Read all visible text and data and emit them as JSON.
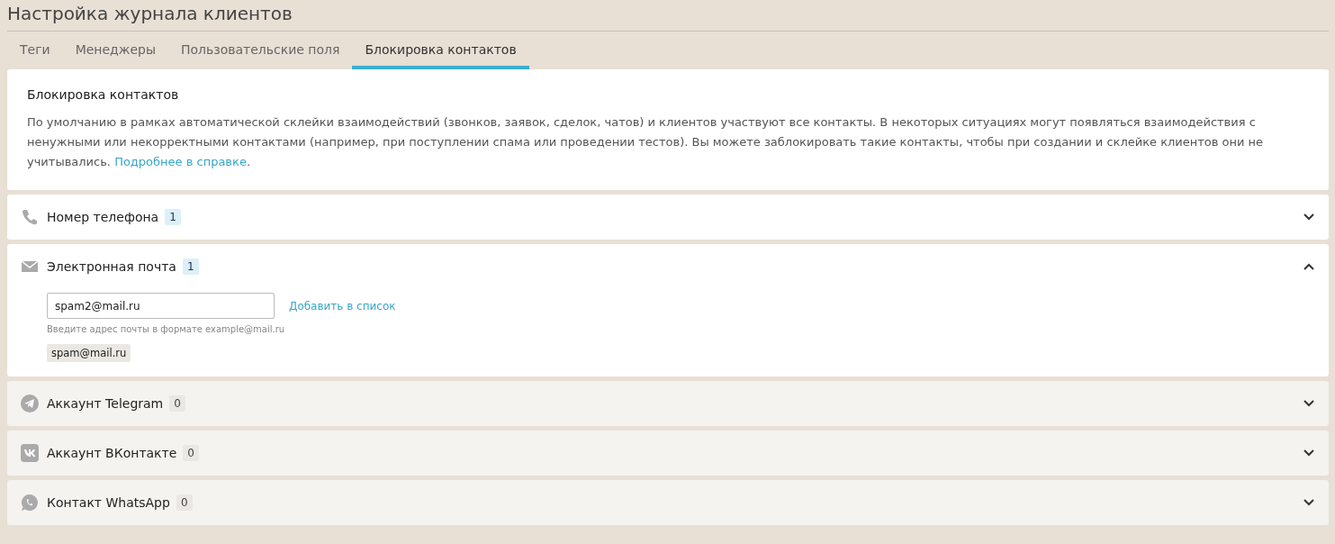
{
  "page": {
    "title": "Настройка журнала клиентов"
  },
  "tabs": [
    {
      "label": "Теги",
      "selected": false
    },
    {
      "label": "Менеджеры",
      "selected": false
    },
    {
      "label": "Пользовательские поля",
      "selected": false
    },
    {
      "label": "Блокировка контактов",
      "selected": true
    }
  ],
  "info": {
    "heading": "Блокировка контактов",
    "text": "По умолчанию в рамках автоматической склейки взаимодействий (звонков, заявок, сделок, чатов) и клиентов участвуют все контакты. В некоторых ситуациях могут появляться взаимодействия с ненужными или некорректными контактами (например, при поступлении спама или проведении тестов). Вы можете заблокировать такие контакты, чтобы при создании и склейке клиентов они не учитывались.",
    "link": "Подробнее в справке",
    "link_suffix": "."
  },
  "sections": [
    {
      "kind": "phone",
      "title": "Номер телефона",
      "count": "1",
      "active": true,
      "expanded": false
    },
    {
      "kind": "email",
      "title": "Электронная почта",
      "count": "1",
      "active": true,
      "expanded": true,
      "input": {
        "value": "spam2@mail.ru"
      },
      "add_link": "Добавить в список",
      "hint": "Введите адрес почты в формате example@mail.ru",
      "entries": [
        "spam@mail.ru"
      ]
    },
    {
      "kind": "telegram",
      "title": "Аккаунт Telegram",
      "count": "0",
      "active": false,
      "expanded": false
    },
    {
      "kind": "vk",
      "title": "Аккаунт ВКонтакте",
      "count": "0",
      "active": false,
      "expanded": false
    },
    {
      "kind": "whatsapp",
      "title": "Контакт WhatsApp",
      "count": "0",
      "active": false,
      "expanded": false
    }
  ]
}
